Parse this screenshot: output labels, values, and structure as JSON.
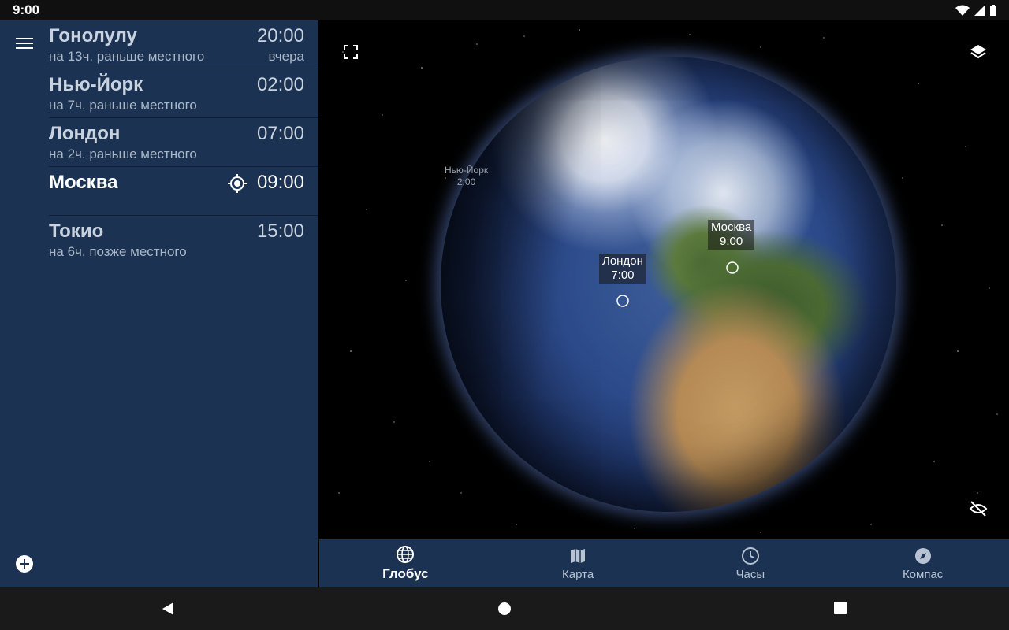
{
  "status_bar": {
    "time": "9:00"
  },
  "cities": [
    {
      "name": "Гонолулу",
      "subtitle": "на 13ч. раньше местного",
      "time": "20:00",
      "day": "вчера",
      "current": false
    },
    {
      "name": "Нью-Йорк",
      "subtitle": "на 7ч. раньше местного",
      "time": "02:00",
      "day": "",
      "current": false
    },
    {
      "name": "Лондон",
      "subtitle": "на 2ч. раньше местного",
      "time": "07:00",
      "day": "",
      "current": false
    },
    {
      "name": "Москва",
      "subtitle": "",
      "time": "09:00",
      "day": "",
      "current": true
    },
    {
      "name": "Токио",
      "subtitle": "на 6ч. позже местного",
      "time": "15:00",
      "day": "",
      "current": false
    }
  ],
  "globe_markers": {
    "newyork": {
      "name": "Нью-Йорк",
      "time": "2:00"
    },
    "london": {
      "name": "Лондон",
      "time": "7:00"
    },
    "moscow": {
      "name": "Москва",
      "time": "9:00"
    }
  },
  "bottom_nav": {
    "items": [
      {
        "label": "Глобус",
        "icon": "globe-icon",
        "active": true
      },
      {
        "label": "Карта",
        "icon": "map-icon",
        "active": false
      },
      {
        "label": "Часы",
        "icon": "clock-icon",
        "active": false
      },
      {
        "label": "Компас",
        "icon": "compass-icon",
        "active": false
      }
    ]
  },
  "colors": {
    "sidebar": "#1b3252",
    "background": "#000000"
  }
}
